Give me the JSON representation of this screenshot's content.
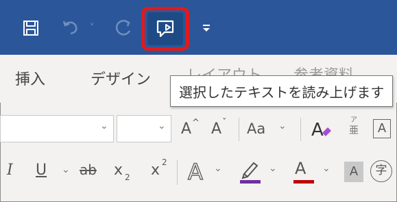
{
  "quick_access": {
    "save_icon": "save-icon",
    "undo_icon": "undo-icon",
    "redo_icon": "redo-icon",
    "read_aloud_icon": "read-aloud-icon",
    "customize_icon": "customize-qat-icon",
    "undo_dropdown": "˅"
  },
  "tabs": {
    "insert": "挿入",
    "design": "デザイン",
    "layout": "レイアウト",
    "references": "参考資料"
  },
  "tooltip": {
    "text": "選択したテキストを読み上げます"
  },
  "font_row": {
    "grow_font": "A",
    "grow_caret": "^",
    "shrink_font": "A",
    "shrink_caret": "ˇ",
    "change_case": "Aa",
    "phonetic_top": "ア",
    "phonetic_bottom": "亜",
    "char_border": "A"
  },
  "format_row": {
    "italic": "I",
    "underline": "U",
    "strikethrough": "ab",
    "subscript_base": "x",
    "subscript_mark": "2",
    "superscript_base": "x",
    "superscript_mark": "2",
    "text_effects": "A",
    "font_color": "A",
    "char_shading": "A",
    "enclose_char": "字"
  },
  "colors": {
    "title_bar": "#2b579a",
    "highlight": "#e21a1a",
    "ribbon_bg": "#f3f2f1",
    "font_color_bar": "#c00000",
    "highlight_pen_bar": "#7030a0"
  }
}
